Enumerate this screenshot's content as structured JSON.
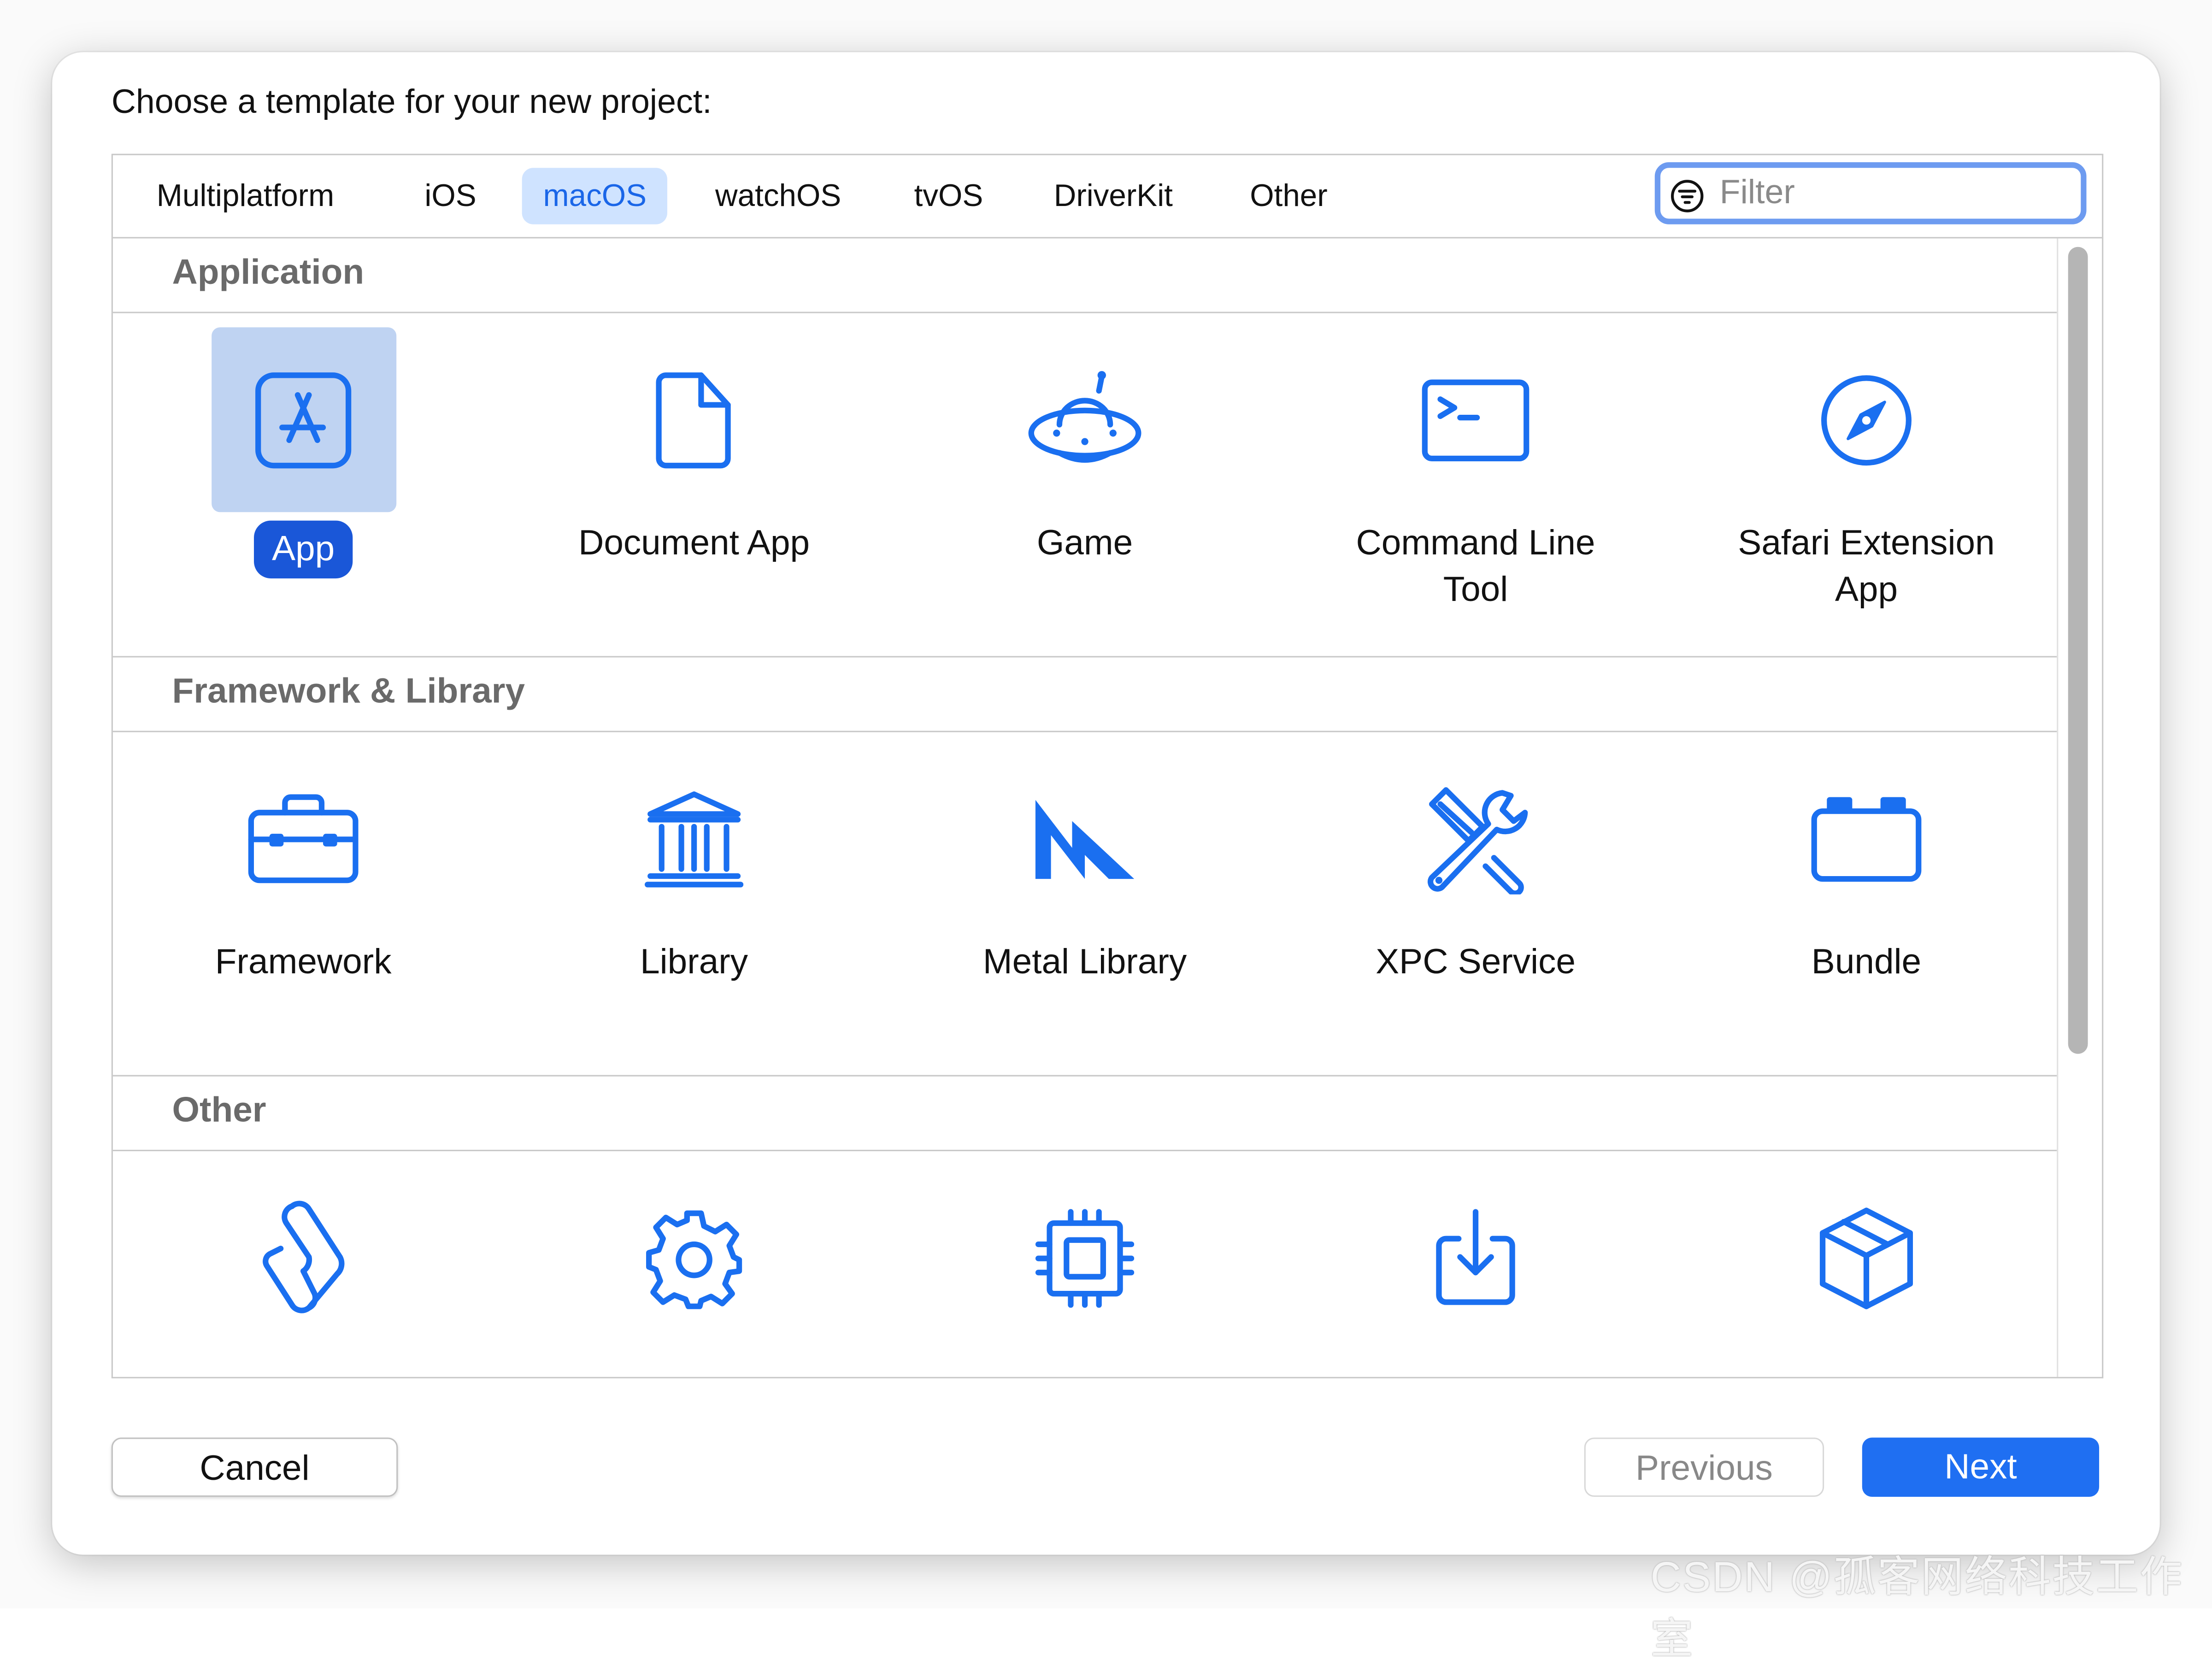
{
  "dialog": {
    "title": "Choose a template for your new project:"
  },
  "tabs": [
    {
      "label": "Multiplatform",
      "selected": false
    },
    {
      "label": "iOS",
      "selected": false
    },
    {
      "label": "macOS",
      "selected": true
    },
    {
      "label": "watchOS",
      "selected": false
    },
    {
      "label": "tvOS",
      "selected": false
    },
    {
      "label": "DriverKit",
      "selected": false
    },
    {
      "label": "Other",
      "selected": false
    }
  ],
  "filter": {
    "placeholder": "Filter",
    "value": "",
    "icon": "filter-circle-icon"
  },
  "sections": [
    {
      "title": "Application",
      "items": [
        {
          "label": "App",
          "icon": "app-store-icon",
          "selected": true
        },
        {
          "label": "Document App",
          "icon": "document-icon",
          "selected": false
        },
        {
          "label": "Game",
          "icon": "ufo-game-icon",
          "selected": false
        },
        {
          "label": "Command Line\nTool",
          "icon": "terminal-icon",
          "selected": false
        },
        {
          "label": "Safari Extension\nApp",
          "icon": "safari-compass-icon",
          "selected": false
        }
      ]
    },
    {
      "title": "Framework & Library",
      "items": [
        {
          "label": "Framework",
          "icon": "toolbox-icon",
          "selected": false
        },
        {
          "label": "Library",
          "icon": "building-columns-icon",
          "selected": false
        },
        {
          "label": "Metal Library",
          "icon": "metal-icon",
          "selected": false
        },
        {
          "label": "XPC Service",
          "icon": "wrench-screwdriver-icon",
          "selected": false
        },
        {
          "label": "Bundle",
          "icon": "bundle-icon",
          "selected": false
        }
      ]
    },
    {
      "title": "Other",
      "items": [
        {
          "label": "",
          "icon": "script-scroll-icon",
          "selected": false
        },
        {
          "label": "",
          "icon": "gear-icon",
          "selected": false
        },
        {
          "label": "",
          "icon": "cpu-chip-icon",
          "selected": false
        },
        {
          "label": "",
          "icon": "download-tray-icon",
          "selected": false
        },
        {
          "label": "",
          "icon": "package-box-icon",
          "selected": false
        }
      ]
    }
  ],
  "buttons": {
    "cancel": "Cancel",
    "previous": "Previous",
    "next": "Next"
  },
  "watermark": "CSDN @孤客网络科技工作室",
  "colors": {
    "accent": "#1f6ff2",
    "selected_tab_bg": "#cfe3ff",
    "selected_item_bg": "#bfd3f2",
    "selected_label_bg": "#1a57d8",
    "focus_ring": "#6d9bf0"
  }
}
